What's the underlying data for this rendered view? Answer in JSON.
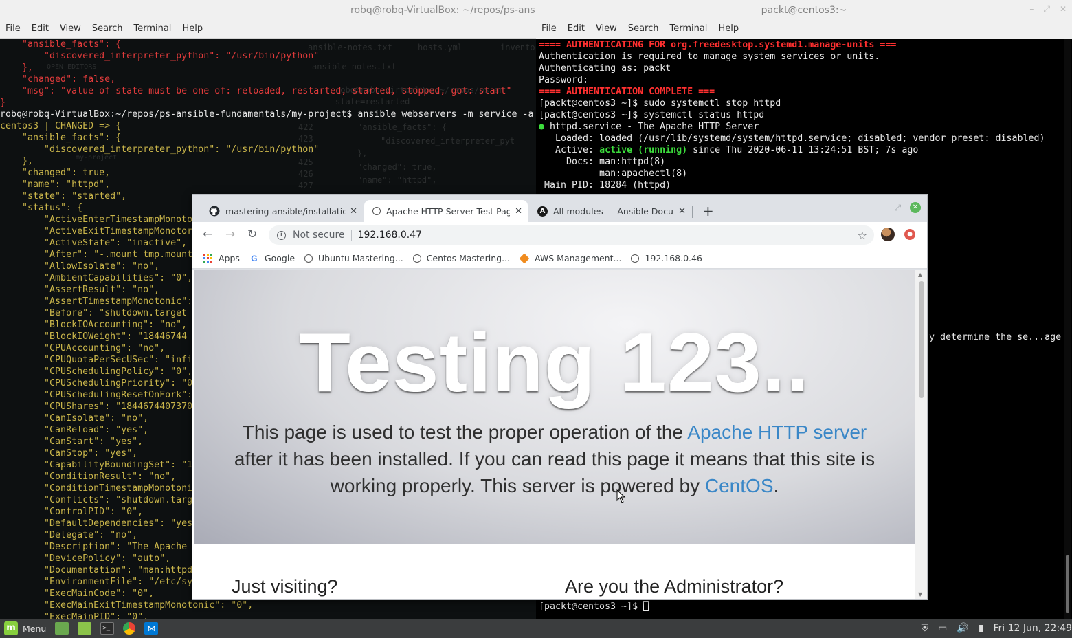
{
  "left_terminal": {
    "title": "robq@robq-VirtualBox: ~/repos/ps-ansible",
    "menu": [
      "File",
      "Edit",
      "View",
      "Search",
      "Terminal",
      "Help"
    ],
    "lines": [
      {
        "t": "    \"ansible_facts\": {",
        "c": "red"
      },
      {
        "t": "        \"discovered_interpreter_python\": \"/usr/bin/python\"",
        "c": "red"
      },
      {
        "t": "    },",
        "c": "red"
      },
      {
        "t": "    \"changed\": false,",
        "c": "red"
      },
      {
        "t": "    \"msg\": \"value of state must be one of: reloaded, restarted, started, stopped, got: start\"",
        "c": "red"
      },
      {
        "t": "}",
        "c": "red"
      },
      {
        "t": "robq@robq-VirtualBox:~/repos/ps-ansible-fundamentals/my-project$ ansible webservers -m service -a",
        "c": "wht"
      },
      {
        "t": "centos3 | CHANGED => {",
        "c": "yel"
      },
      {
        "t": "    \"ansible_facts\": {",
        "c": "yel"
      },
      {
        "t": "        \"discovered_interpreter_python\": \"/usr/bin/python\"",
        "c": "yel"
      },
      {
        "t": "    },",
        "c": "yel"
      },
      {
        "t": "    \"changed\": true,",
        "c": "yel"
      },
      {
        "t": "    \"name\": \"httpd\",",
        "c": "yel"
      },
      {
        "t": "    \"state\": \"started\",",
        "c": "yel"
      },
      {
        "t": "    \"status\": {",
        "c": "yel"
      },
      {
        "t": "        \"ActiveEnterTimestampMonoto",
        "c": "yel"
      },
      {
        "t": "        \"ActiveExitTimestampMonotor",
        "c": "yel"
      },
      {
        "t": "        \"ActiveState\": \"inactive\",",
        "c": "yel"
      },
      {
        "t": "        \"After\": \"-.mount tmp.mount",
        "c": "yel"
      },
      {
        "t": "        \"AllowIsolate\": \"no\",",
        "c": "yel"
      },
      {
        "t": "        \"AmbientCapabilities\": \"0\",",
        "c": "yel"
      },
      {
        "t": "        \"AssertResult\": \"no\",",
        "c": "yel"
      },
      {
        "t": "        \"AssertTimestampMonotonic\":",
        "c": "yel"
      },
      {
        "t": "        \"Before\": \"shutdown.target",
        "c": "yel"
      },
      {
        "t": "        \"BlockIOAccounting\": \"no\",",
        "c": "yel"
      },
      {
        "t": "        \"BlockIOWeight\": \"18446744",
        "c": "yel"
      },
      {
        "t": "        \"CPUAccounting\": \"no\",",
        "c": "yel"
      },
      {
        "t": "        \"CPUQuotaPerSecUSec\": \"infi",
        "c": "yel"
      },
      {
        "t": "        \"CPUSchedulingPolicy\": \"0\",",
        "c": "yel"
      },
      {
        "t": "        \"CPUSchedulingPriority\": \"0",
        "c": "yel"
      },
      {
        "t": "        \"CPUSchedulingResetOnFork\":",
        "c": "yel"
      },
      {
        "t": "        \"CPUShares\": \"1844674407370",
        "c": "yel"
      },
      {
        "t": "        \"CanIsolate\": \"no\",",
        "c": "yel"
      },
      {
        "t": "        \"CanReload\": \"yes\",",
        "c": "yel"
      },
      {
        "t": "        \"CanStart\": \"yes\",",
        "c": "yel"
      },
      {
        "t": "        \"CanStop\": \"yes\",",
        "c": "yel"
      },
      {
        "t": "        \"CapabilityBoundingSet\": \"1",
        "c": "yel"
      },
      {
        "t": "        \"ConditionResult\": \"no\",",
        "c": "yel"
      },
      {
        "t": "        \"ConditionTimestampMonotoni",
        "c": "yel"
      },
      {
        "t": "        \"Conflicts\": \"shutdown.targ",
        "c": "yel"
      },
      {
        "t": "        \"ControlPID\": \"0\",",
        "c": "yel"
      },
      {
        "t": "        \"DefaultDependencies\": \"yes",
        "c": "yel"
      },
      {
        "t": "        \"Delegate\": \"no\",",
        "c": "yel"
      },
      {
        "t": "        \"Description\": \"The Apache ",
        "c": "yel"
      },
      {
        "t": "        \"DevicePolicy\": \"auto\",",
        "c": "yel"
      },
      {
        "t": "        \"Documentation\": \"man:httpd",
        "c": "yel"
      },
      {
        "t": "        \"EnvironmentFile\": \"/etc/sy",
        "c": "yel"
      },
      {
        "t": "        \"ExecMainCode\": \"0\",",
        "c": "yel"
      },
      {
        "t": "        \"ExecMainExitTimestampMonotonic\": \"0\",",
        "c": "yel"
      },
      {
        "t": "        \"ExecMainPID\": \"0\",",
        "c": "yel"
      }
    ],
    "ghost": {
      "tabs": [
        "ansible-notes.txt",
        "hosts.yml",
        "invento"
      ],
      "file_label": "ansible-notes.txt",
      "open_editors": "OPEN EDITORS",
      "line_numbers": [
        "422",
        "423",
        "424",
        "425",
        "426",
        "427"
      ],
      "code": [
        "robq@robq-VirtualBox:~/repos/ps-an",
        "state=restarted",
        "\"ansible_facts\": {",
        "\"discovered_interpreter_pyt",
        "},",
        "\"changed\": true,",
        "\"name\": \"httpd\","
      ],
      "folder": "my-project"
    }
  },
  "right_terminal": {
    "title": "packt@centos3:~",
    "menu": [
      "File",
      "Edit",
      "View",
      "Search",
      "Terminal",
      "Help"
    ],
    "lines": [
      [
        {
          "t": "==== AUTHENTICATING FOR org.freedesktop.systemd1.manage-units ===",
          "s": "red"
        }
      ],
      [
        {
          "t": "Authentication is required to manage system services or units.",
          "s": ""
        }
      ],
      [
        {
          "t": "Authenticating as: packt",
          "s": ""
        }
      ],
      [
        {
          "t": "Password:",
          "s": ""
        }
      ],
      [
        {
          "t": "==== AUTHENTICATION COMPLETE ===",
          "s": "red"
        }
      ],
      [
        {
          "t": "[packt@centos3 ~]$ sudo systemctl stop httpd",
          "s": ""
        }
      ],
      [
        {
          "t": "[packt@centos3 ~]$ systemctl status httpd",
          "s": ""
        }
      ],
      [
        {
          "t": "●",
          "s": "green"
        },
        {
          "t": " httpd.service - The Apache HTTP Server",
          "s": ""
        }
      ],
      [
        {
          "t": "   Loaded: loaded (/usr/lib/systemd/system/httpd.service; disabled; vendor preset: disabled)",
          "s": ""
        }
      ],
      [
        {
          "t": "   Active: ",
          "s": ""
        },
        {
          "t": "active (running)",
          "s": "green"
        },
        {
          "t": " since Thu 2020-06-11 13:24:51 BST; 7s ago",
          "s": ""
        }
      ],
      [
        {
          "t": "     Docs: man:httpd(8)",
          "s": ""
        }
      ],
      [
        {
          "t": "           man:apachectl(8)",
          "s": ""
        }
      ],
      [
        {
          "t": " Main PID: 18284 (httpd)",
          "s": ""
        }
      ]
    ],
    "partial_line": "y determine the se...age",
    "prompt": "[packt@centos3 ~]$ "
  },
  "browser": {
    "tabs": [
      {
        "label": "mastering-ansible/installation-a",
        "icon": "github-icon",
        "active": false
      },
      {
        "label": "Apache HTTP Server Test Page",
        "icon": "globe-icon",
        "active": true
      },
      {
        "label": "All modules — Ansible Docume",
        "icon": "ansible-icon",
        "active": false
      }
    ],
    "security": "Not secure",
    "url": "192.168.0.47",
    "bookmarks": [
      {
        "label": "Apps",
        "icon": "apps-icon"
      },
      {
        "label": "Google",
        "icon": "google-icon"
      },
      {
        "label": "Ubuntu Mastering...",
        "icon": "globe-icon"
      },
      {
        "label": "Centos Mastering...",
        "icon": "globe-icon"
      },
      {
        "label": "AWS Management...",
        "icon": "aws-icon"
      },
      {
        "label": "192.168.0.46",
        "icon": "globe-icon"
      }
    ],
    "page": {
      "heading": "Testing 123..",
      "para_before": "This page is used to test the proper operation of the ",
      "link1": "Apache HTTP server",
      "para_middle": " after it has been installed. If you can read this page it means that this site is working properly. This server is powered by ",
      "link2": "CentOS",
      "para_end": ".",
      "link_color": "#3a87c7",
      "section_left": "Just visiting?",
      "section_right": "Are you the Administrator?"
    }
  },
  "taskbar": {
    "menu_label": "Menu",
    "clock": "Fri 12 Jun, 22:49"
  }
}
